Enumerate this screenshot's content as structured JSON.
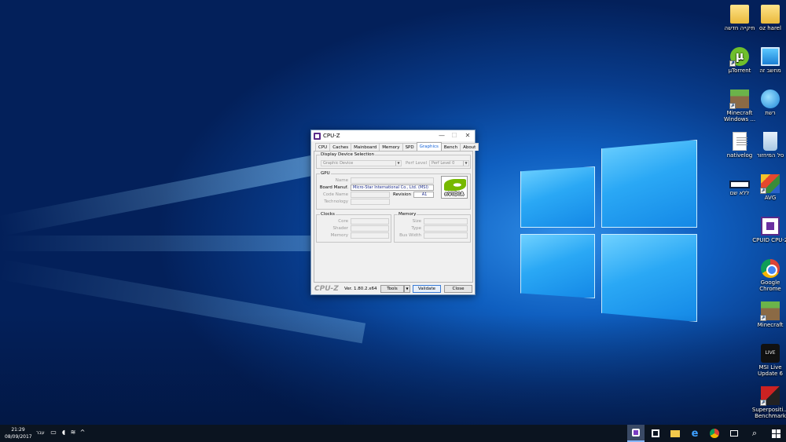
{
  "desktop": {
    "icons": [
      {
        "id": "folder-new",
        "label": "תיקייה חדשה",
        "icon": "folder-icon"
      },
      {
        "id": "oz-harel",
        "label": "oz harel",
        "icon": "user-folder-icon"
      },
      {
        "id": "utorrent",
        "label": "µTorrent",
        "icon": "utorrent-icon"
      },
      {
        "id": "this-pc",
        "label": "מחשב זה",
        "icon": "computer-icon"
      },
      {
        "id": "minecraft-win",
        "label": "Minecraft Windows ...",
        "icon": "minecraft-icon"
      },
      {
        "id": "network",
        "label": "רשת",
        "icon": "network-icon"
      },
      {
        "id": "nativelog",
        "label": "nativelog",
        "icon": "document-icon"
      },
      {
        "id": "recycle-bin",
        "label": "סל המיחזור",
        "icon": "recycle-bin-icon"
      },
      {
        "id": "untitled",
        "label": "ללא שם",
        "icon": "blank-shortcut-icon"
      },
      {
        "id": "avg",
        "label": "AVG",
        "icon": "avg-icon"
      },
      {
        "id": "cpuid",
        "label": "CPUID CPU-Z",
        "icon": "cpuz-icon"
      },
      {
        "id": "chrome",
        "label": "Google Chrome",
        "icon": "chrome-icon"
      },
      {
        "id": "minecraft",
        "label": "Minecraft",
        "icon": "minecraft-icon"
      },
      {
        "id": "msi-live",
        "label": "MSI Live Update 6",
        "icon": "msi-live-update-icon"
      },
      {
        "id": "superposition",
        "label": "Superpositi... Benchmark",
        "icon": "superposition-icon"
      }
    ]
  },
  "cpuz": {
    "title": "CPU-Z",
    "tabs": [
      "CPU",
      "Caches",
      "Mainboard",
      "Memory",
      "SPD",
      "Graphics",
      "Bench",
      "About"
    ],
    "active_tab": "Graphics",
    "display_selection": {
      "group_label": "Display Device Selection",
      "device_value": "Graphic Device",
      "perf_label": "Perf Level",
      "perf_value": "Perf Level 0"
    },
    "gpu": {
      "group_label": "GPU",
      "name_label": "Name",
      "name_value": "",
      "board_label": "Board Manuf.",
      "board_value": "Micro-Star International Co., Ltd. (MSI)",
      "code_label": "Code Name",
      "code_value": "",
      "revision_label": "Revision",
      "revision_value": "A1",
      "tech_label": "Technology",
      "tech_value": "",
      "logo_text": "nVIDIA"
    },
    "clocks": {
      "group_label": "Clocks",
      "rows": [
        "Core",
        "Shader",
        "Memory"
      ]
    },
    "memory": {
      "group_label": "Memory",
      "rows": [
        "Size",
        "Type",
        "Bus Width"
      ]
    },
    "footer": {
      "brand": "CPU-Z",
      "version": "Ver. 1.80.2.x64",
      "tools": "Tools",
      "validate": "Validate",
      "close": "Close"
    },
    "window_controls": {
      "minimize": "—",
      "maximize": "☐",
      "close": "✕"
    }
  },
  "taskbar": {
    "time": "21:29",
    "date": "08/09/2017",
    "language": "עבר"
  },
  "colors": {
    "accent_link": "#1060d8",
    "value_text": "#1a2a8a",
    "taskbar": "#0b1420"
  }
}
